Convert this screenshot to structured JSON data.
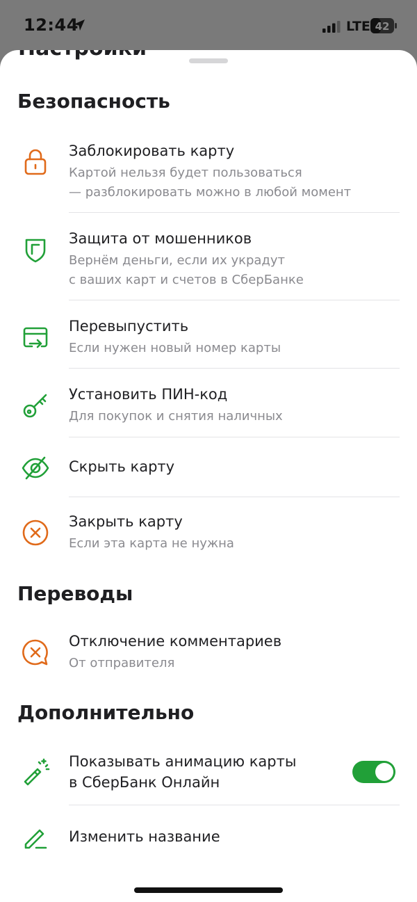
{
  "status_bar": {
    "time": "12:44",
    "network": "LTE",
    "battery_level": "42"
  },
  "sheet": {
    "title": "Настройки"
  },
  "sections": {
    "security": {
      "title": "Безопасность",
      "items": [
        {
          "title": "Заблокировать карту",
          "subtitle_1": "Картой нельзя будет пользоваться",
          "subtitle_2": "— разблокировать можно в любой момент",
          "icon": "lock-icon",
          "color": "#e06a1a"
        },
        {
          "title": "Защита от мошенников",
          "subtitle_1": "Вернём деньги, если их украдут",
          "subtitle_2": "с ваших карт и счетов в СберБанке",
          "icon": "shield-icon",
          "color": "#21a038"
        },
        {
          "title": "Перевыпустить",
          "subtitle_1": "Если нужен новый номер карты",
          "icon": "card-reissue-icon",
          "color": "#21a038"
        },
        {
          "title": "Установить ПИН-код",
          "subtitle_1": "Для покупок и снятия наличных",
          "icon": "key-icon",
          "color": "#21a038"
        },
        {
          "title": "Скрыть карту",
          "icon": "eye-off-icon",
          "color": "#21a038"
        },
        {
          "title": "Закрыть карту",
          "subtitle_1": "Если эта карта не нужна",
          "icon": "close-circle-icon",
          "color": "#e06a1a"
        }
      ]
    },
    "transfers": {
      "title": "Переводы",
      "items": [
        {
          "title": "Отключение комментариев",
          "subtitle_1": "От отправителя",
          "icon": "comment-off-icon",
          "color": "#e06a1a"
        }
      ]
    },
    "additional": {
      "title": "Дополнительно",
      "items": [
        {
          "title_1": "Показывать анимацию карты",
          "title_2": "в СберБанк Онлайн",
          "icon": "magic-wand-icon",
          "color": "#21a038",
          "toggle_on": true
        },
        {
          "title": "Изменить название",
          "icon": "pencil-icon",
          "color": "#21a038"
        }
      ]
    }
  }
}
